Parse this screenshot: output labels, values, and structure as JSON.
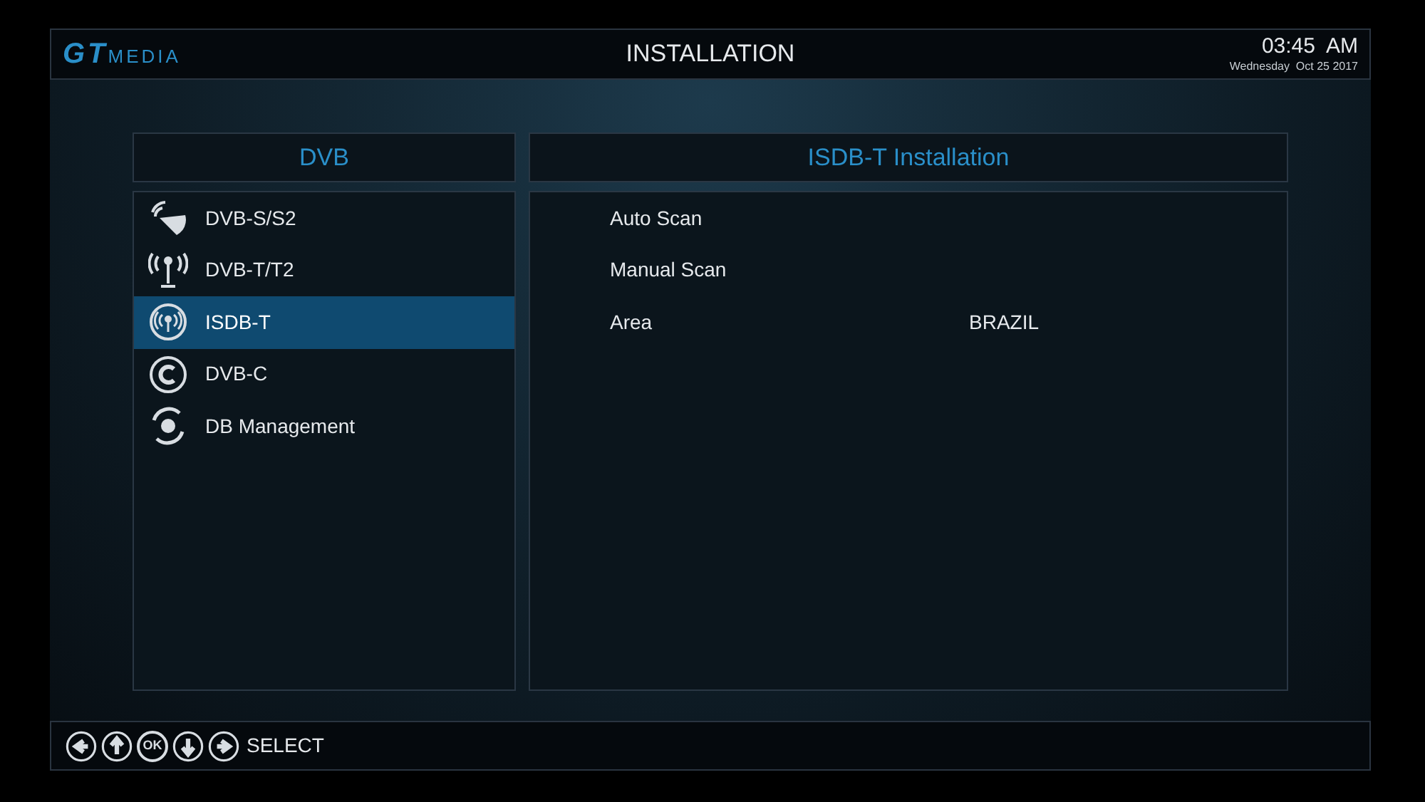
{
  "header": {
    "logo": {
      "bold": "GT",
      "small": "MEDIA"
    },
    "title": "INSTALLATION",
    "time": "03:45  AM",
    "date": "Wednesday  Oct 25 2017"
  },
  "sidebar": {
    "title": "DVB",
    "items": [
      {
        "kind": "satellite",
        "label": "DVB-S/S2",
        "selected": false
      },
      {
        "kind": "antenna",
        "label": "DVB-T/T2",
        "selected": false
      },
      {
        "kind": "broadcast",
        "label": "ISDB-T",
        "selected": true
      },
      {
        "kind": "cable",
        "label": "DVB-C",
        "selected": false
      },
      {
        "kind": "database",
        "label": "DB Management",
        "selected": false
      }
    ]
  },
  "panel": {
    "title": "ISDB-T Installation",
    "rows": [
      {
        "label": "Auto Scan"
      },
      {
        "label": "Manual Scan"
      },
      {
        "label": "Area",
        "value": "BRAZIL"
      }
    ]
  },
  "footer": {
    "keys": [
      {
        "kind": "left"
      },
      {
        "kind": "up"
      },
      {
        "kind": "ok",
        "text": "OK"
      },
      {
        "kind": "down"
      },
      {
        "kind": "right"
      }
    ],
    "hint": "SELECT"
  }
}
